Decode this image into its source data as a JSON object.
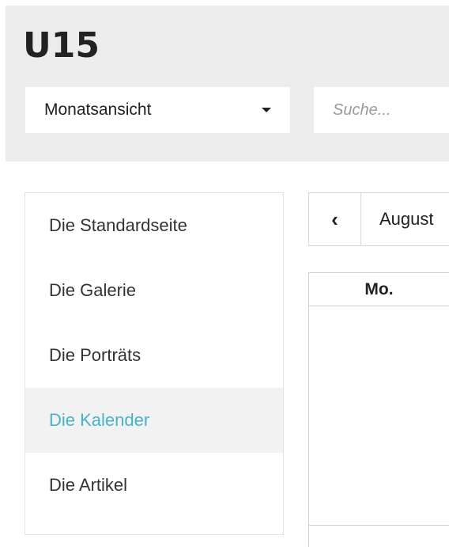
{
  "header": {
    "title": "U15",
    "view_select": {
      "selected": "Monatsansicht"
    },
    "search": {
      "placeholder": "Suche..."
    }
  },
  "sidebar": {
    "items": [
      {
        "label": "Die Standardseite",
        "active": false
      },
      {
        "label": "Die Galerie",
        "active": false
      },
      {
        "label": "Die Porträts",
        "active": false
      },
      {
        "label": "Die Kalender",
        "active": true
      },
      {
        "label": "Die Artikel",
        "active": false
      }
    ]
  },
  "calendar": {
    "prev_icon": "chevron-left-icon",
    "month_label": "August",
    "weekday_first": "Mo."
  },
  "colors": {
    "active_link": "#45b3c8",
    "header_background": "#ececec",
    "active_item_background": "#f2f2f2"
  }
}
